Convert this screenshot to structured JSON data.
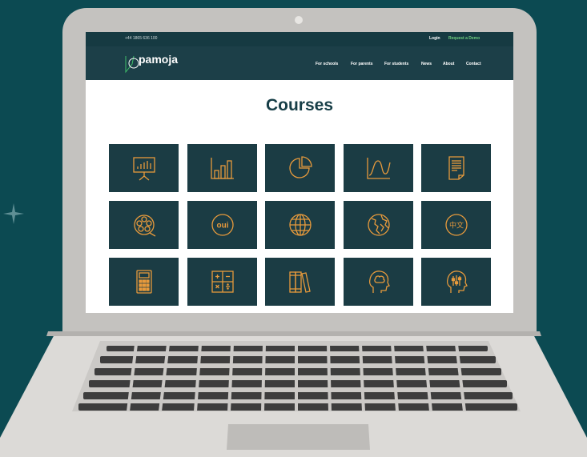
{
  "site": {
    "phone": "+44 1865 636 100",
    "login_label": "Login",
    "demo_label": "Request a Demo",
    "logo_text": "pamoja",
    "nav": [
      "For schools",
      "For parents",
      "For students",
      "News",
      "About",
      "Contact"
    ]
  },
  "page": {
    "title": "Courses"
  },
  "tiles": [
    {
      "icon": "presentation-chart-icon"
    },
    {
      "icon": "bar-chart-icon"
    },
    {
      "icon": "pie-chart-icon"
    },
    {
      "icon": "line-graph-icon"
    },
    {
      "icon": "document-icon"
    },
    {
      "icon": "film-reel-icon"
    },
    {
      "icon": "oui-language-icon",
      "label": "oui"
    },
    {
      "icon": "globe-icon"
    },
    {
      "icon": "world-map-globe-icon"
    },
    {
      "icon": "chinese-language-icon",
      "label": "中文"
    },
    {
      "icon": "calculator-icon"
    },
    {
      "icon": "math-operators-icon"
    },
    {
      "icon": "books-icon"
    },
    {
      "icon": "brain-head-icon"
    },
    {
      "icon": "equalizer-head-icon"
    }
  ],
  "colors": {
    "background": "#0c4a52",
    "tile": "#1b3c44",
    "icon_stroke": "#e79a3c",
    "accent_green": "#6fcf7f"
  }
}
